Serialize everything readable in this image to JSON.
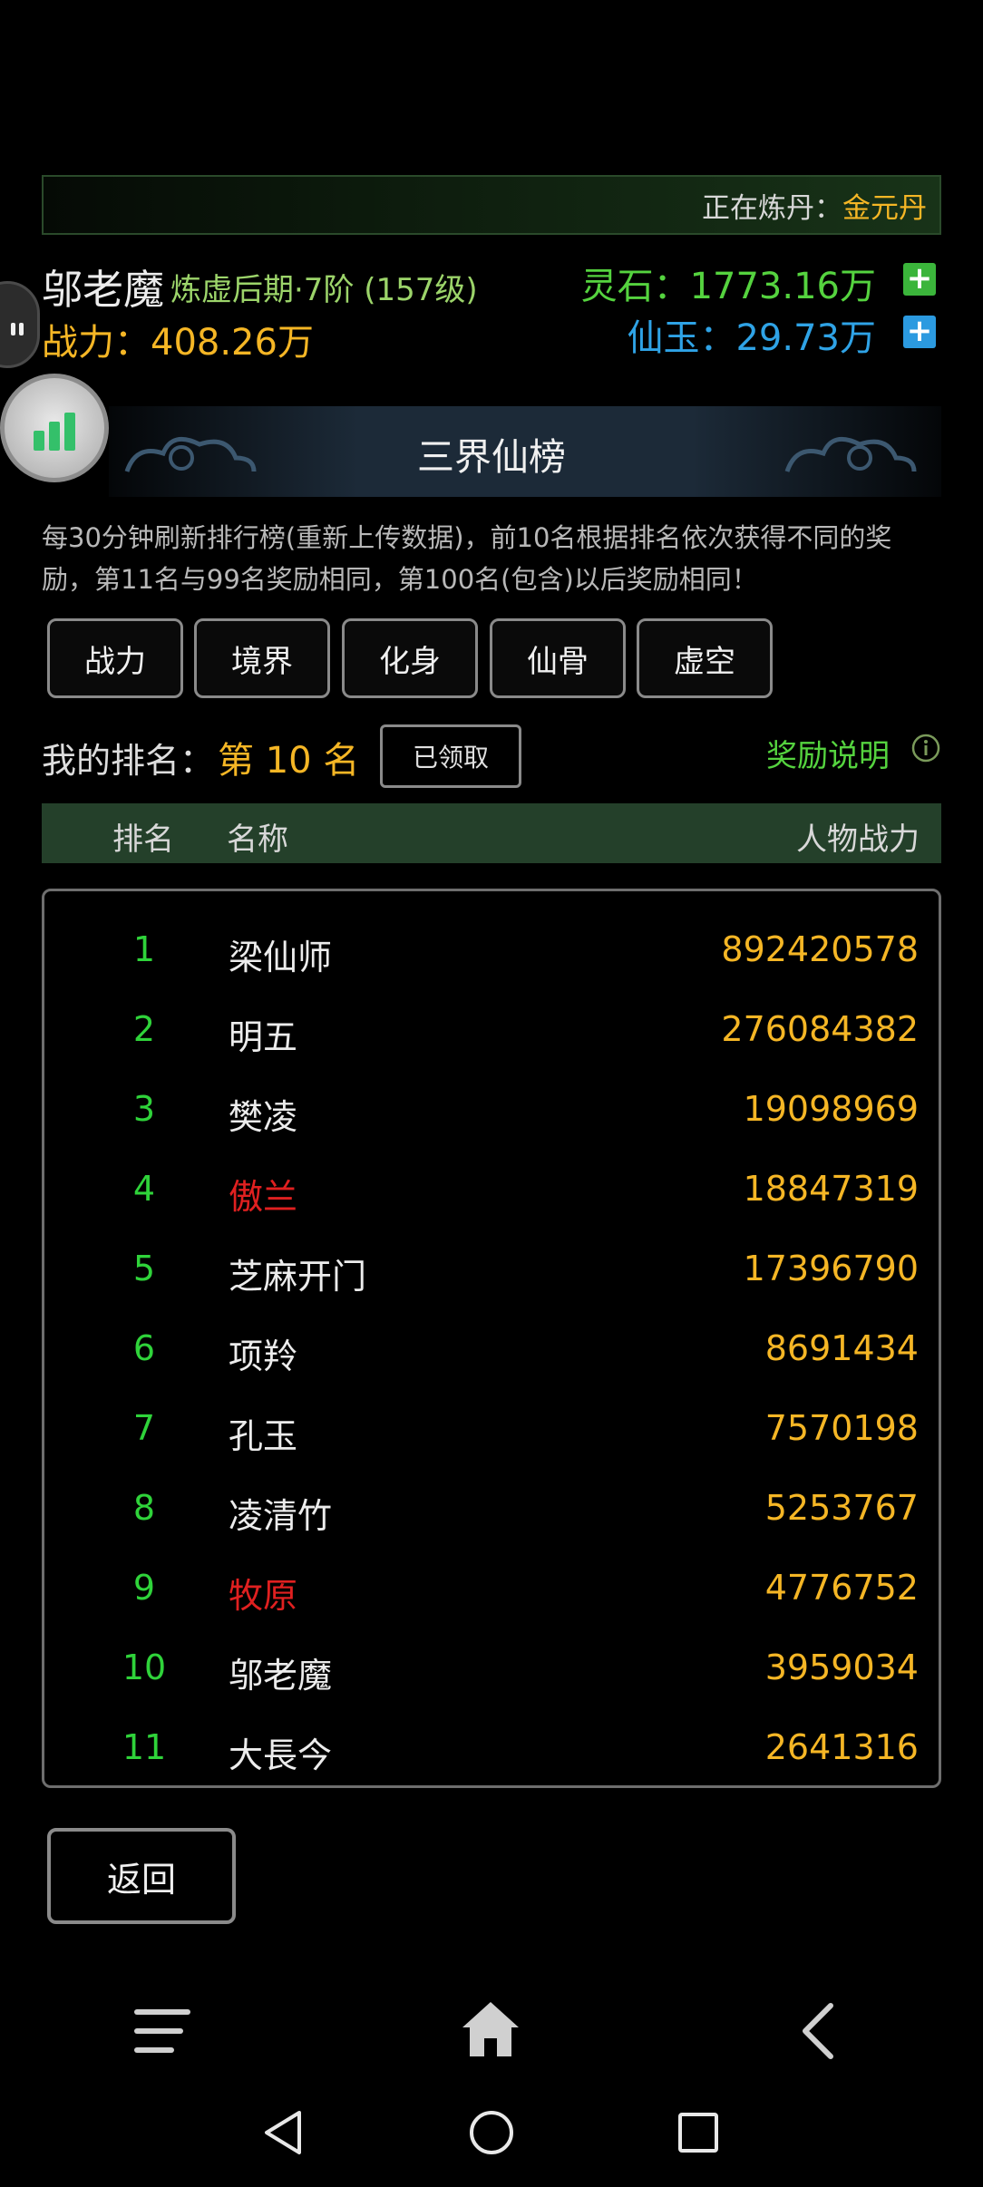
{
  "alchemy": {
    "label": "正在炼丹：",
    "value": "金元丹"
  },
  "player": {
    "name": "邬老魔",
    "realm": "炼虚后期·7阶 (157级)",
    "power": "战力：408.26万",
    "spirit_stone": "灵石：1773.16万",
    "immortal_jade": "仙玉：29.73万",
    "plus": "+"
  },
  "ranking": {
    "title": "三界仙榜",
    "notice": "每30分钟刷新排行榜(重新上传数据)，前10名根据排名依次获得不同的奖励，第11名与99名奖励相同，第100名(包含)以后奖励相同！",
    "tabs": [
      "战力",
      "境界",
      "化身",
      "仙骨",
      "虚空"
    ],
    "my_rank_label": "我的排名：",
    "my_rank_value": "第 10 名",
    "claimed": "已领取",
    "reward_info": "奖励说明",
    "columns": {
      "rank": "排名",
      "name": "名称",
      "power": "人物战力"
    },
    "rows": [
      {
        "rank": "1",
        "name": "梁仙师",
        "power": "892420578",
        "highlight": false
      },
      {
        "rank": "2",
        "name": "明五",
        "power": "276084382",
        "highlight": false
      },
      {
        "rank": "3",
        "name": "樊凌",
        "power": "19098969",
        "highlight": false
      },
      {
        "rank": "4",
        "name": "傲兰",
        "power": "18847319",
        "highlight": true
      },
      {
        "rank": "5",
        "name": "芝麻开门",
        "power": "17396790",
        "highlight": false
      },
      {
        "rank": "6",
        "name": "项羚",
        "power": "8691434",
        "highlight": false
      },
      {
        "rank": "7",
        "name": "孔玉",
        "power": "7570198",
        "highlight": false
      },
      {
        "rank": "8",
        "name": "凌清竹",
        "power": "5253767",
        "highlight": false
      },
      {
        "rank": "9",
        "name": "牧原",
        "power": "4776752",
        "highlight": true
      },
      {
        "rank": "10",
        "name": "邬老魔",
        "power": "3959034",
        "highlight": false
      },
      {
        "rank": "11",
        "name": "大長今",
        "power": "2641316",
        "highlight": false
      }
    ],
    "back": "返回"
  },
  "icons": {
    "app_nav": [
      "menu-icon",
      "home-icon",
      "back-chevron-icon"
    ],
    "system_nav": [
      "back-triangle-icon",
      "home-circle-icon",
      "recents-square-icon"
    ]
  },
  "colors": {
    "gold": "#f5b625",
    "green": "#55d33f",
    "blue": "#2fa3e6",
    "red": "#e02020"
  }
}
